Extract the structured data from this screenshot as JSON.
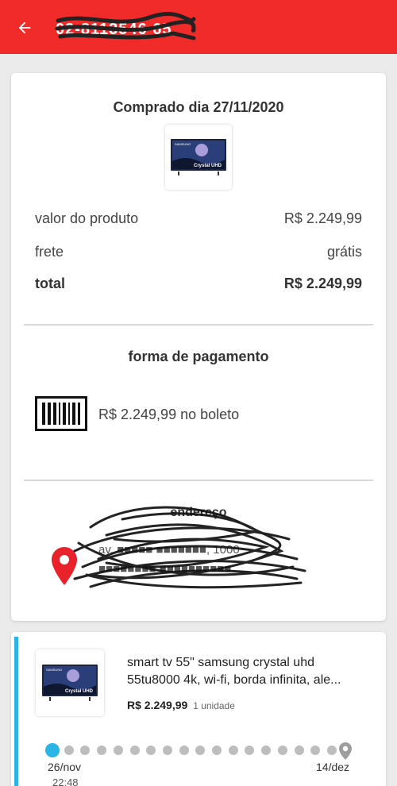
{
  "header": {
    "order_id": "02-8113546 65",
    "back_icon": "arrow-left-icon",
    "bar_color": "#f12a2a"
  },
  "summary": {
    "purchase_date_label": "Comprado dia 27/11/2020",
    "product_thumb_icon": "tv-product-image",
    "product_brand": "SAMSUNG",
    "product_badge": "Crystal UHD",
    "rows": [
      {
        "label": "valor do produto",
        "value": "R$ 2.249,99"
      },
      {
        "label": "frete",
        "value": "grátis"
      },
      {
        "label": "total",
        "value": "R$ 2.249,99"
      }
    ]
  },
  "payment": {
    "title": "forma de pagamento",
    "icon": "barcode-boleto-icon",
    "text": "R$ 2.249,99 no boleto"
  },
  "address": {
    "title": "endereço",
    "icon": "map-pin-icon",
    "pin_color": "#e8212a",
    "line1": "av. ■■■■■ ■■■■■■■, 1000",
    "line2": "■■■■■■■■ ■■■■■■■■■■"
  },
  "item": {
    "accent_color": "#2bb5e6",
    "name_line1": "smart tv 55\" samsung crystal uhd",
    "name_line2": "55tu8000 4k, wi-fi, borda infinita, ale...",
    "price": "R$ 2.249,99",
    "quantity": "1 unidade",
    "timeline": {
      "start_date": "26/nov",
      "start_time": "22:48",
      "end_date": "14/dez",
      "step_count": 18,
      "current_step": 0,
      "end_icon": "destination-pin-icon"
    }
  }
}
